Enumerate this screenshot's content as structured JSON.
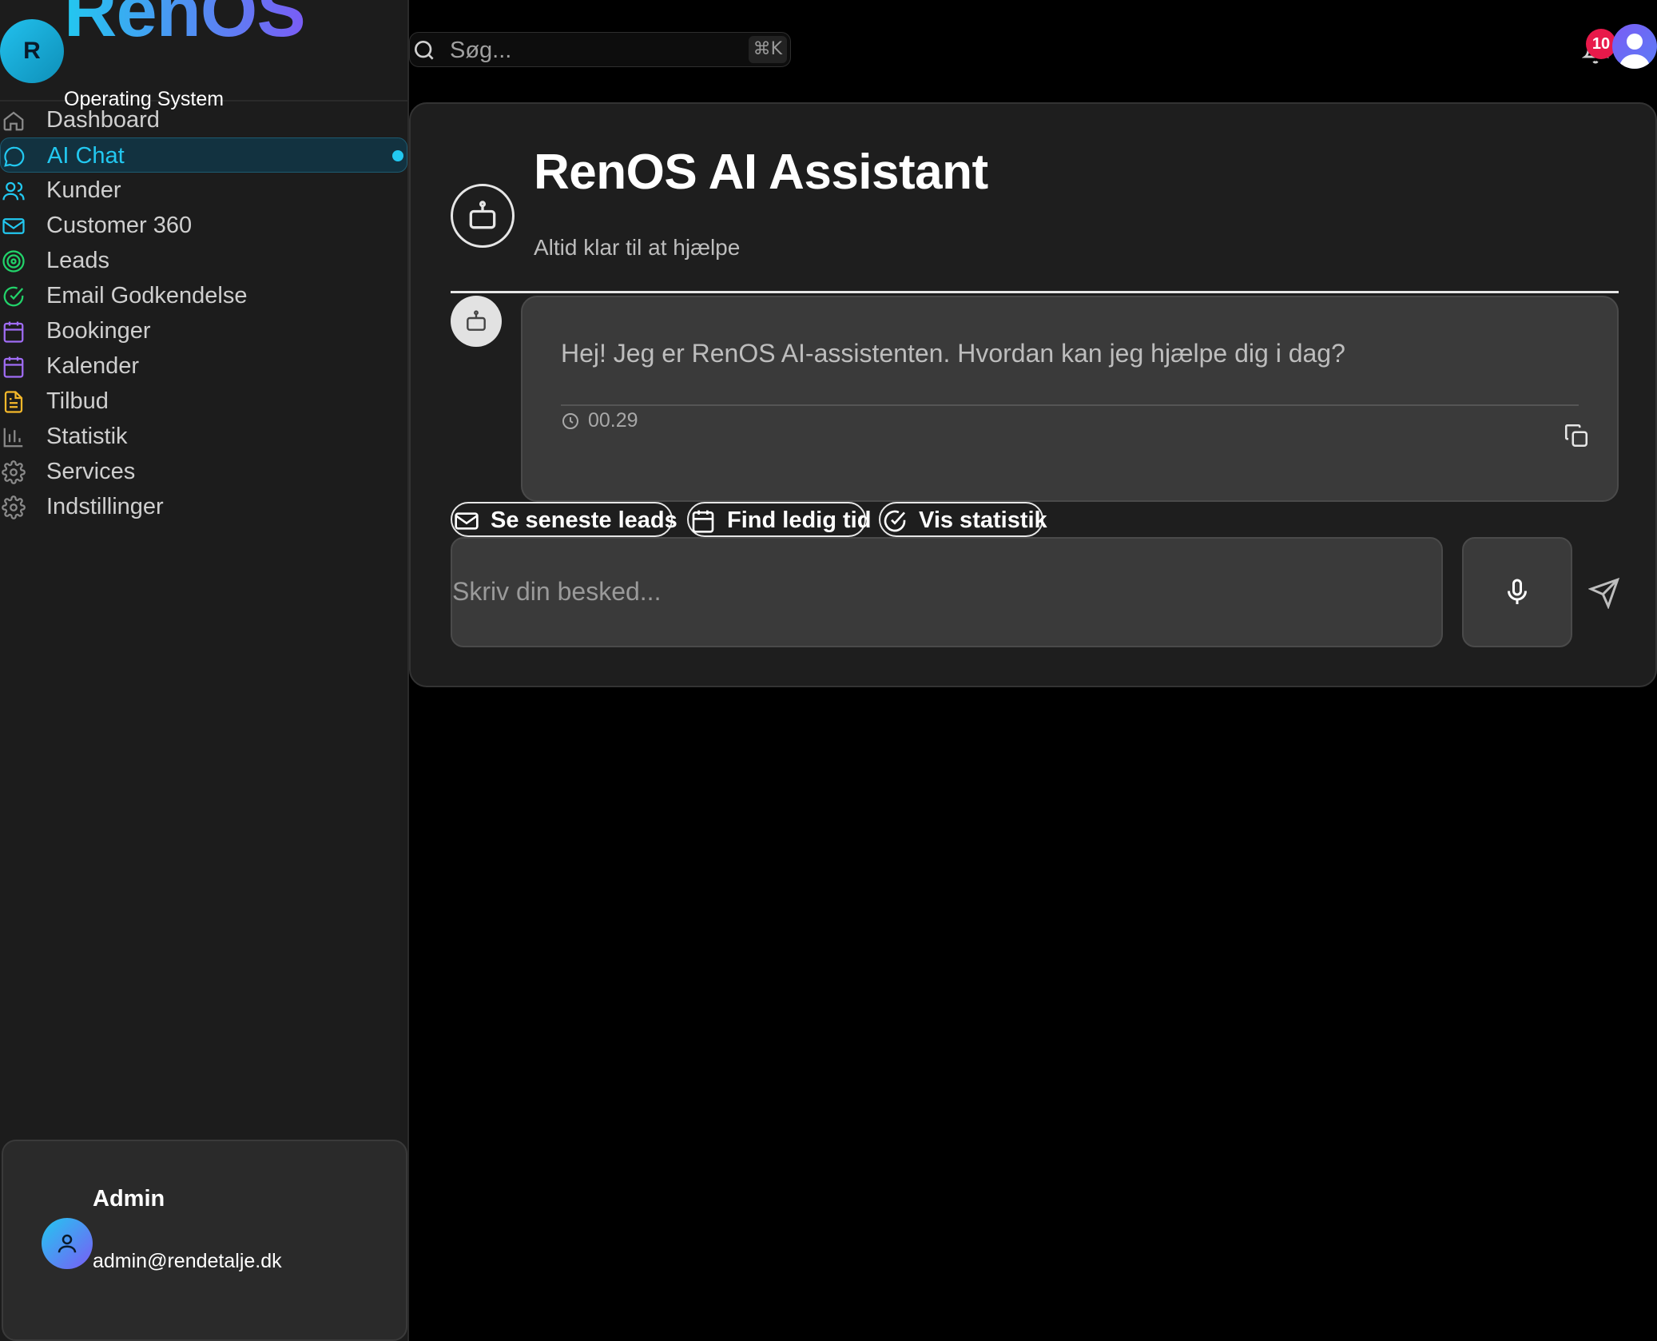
{
  "brand": {
    "logo_letter": "R",
    "name": "RenOS",
    "subtitle": "Operating System"
  },
  "nav": [
    {
      "label": "Dashboard",
      "icon": "home-icon",
      "color": "#8a8a8a"
    },
    {
      "label": "AI Chat",
      "icon": "chat-icon",
      "color": "#22c8f0",
      "active": true
    },
    {
      "label": "Kunder",
      "icon": "users-icon",
      "color": "#22c8f0"
    },
    {
      "label": "Customer 360",
      "icon": "mail-icon",
      "color": "#22c8f0"
    },
    {
      "label": "Leads",
      "icon": "target-icon",
      "color": "#22d36a"
    },
    {
      "label": "Email Godkendelse",
      "icon": "check-circle-icon",
      "color": "#22d36a"
    },
    {
      "label": "Bookinger",
      "icon": "calendar-icon",
      "color": "#a06cf5"
    },
    {
      "label": "Kalender",
      "icon": "calendar-grid-icon",
      "color": "#a06cf5"
    },
    {
      "label": "Tilbud",
      "icon": "document-icon",
      "color": "#f5b82a"
    },
    {
      "label": "Statistik",
      "icon": "bar-chart-icon",
      "color": "#8a8a8a"
    },
    {
      "label": "Services",
      "icon": "gear-icon",
      "color": "#8a8a8a"
    },
    {
      "label": "Indstillinger",
      "icon": "settings-icon",
      "color": "#8a8a8a"
    }
  ],
  "user": {
    "name": "Admin",
    "email": "admin@rendetalje.dk"
  },
  "search": {
    "placeholder": "Søg...",
    "shortcut": "⌘K"
  },
  "notifications": {
    "count": "10"
  },
  "chat": {
    "title": "RenOS AI Assistant",
    "subtitle": "Altid klar til at hjælpe",
    "messages": [
      {
        "text": "Hej! Jeg er RenOS AI-assistenten. Hvordan kan jeg hjælpe dig i dag?",
        "time": "00.29"
      }
    ],
    "quick_actions": [
      {
        "label": "Se seneste leads",
        "icon": "mail-icon"
      },
      {
        "label": "Find ledig tid",
        "icon": "calendar-icon"
      },
      {
        "label": "Vis statistik",
        "icon": "check-circle-icon"
      }
    ],
    "input_placeholder": "Skriv din besked..."
  },
  "colors": {
    "accent": "#22c8f0",
    "brand_gradient_end": "#7a5cf5",
    "badge": "#e8194a"
  }
}
